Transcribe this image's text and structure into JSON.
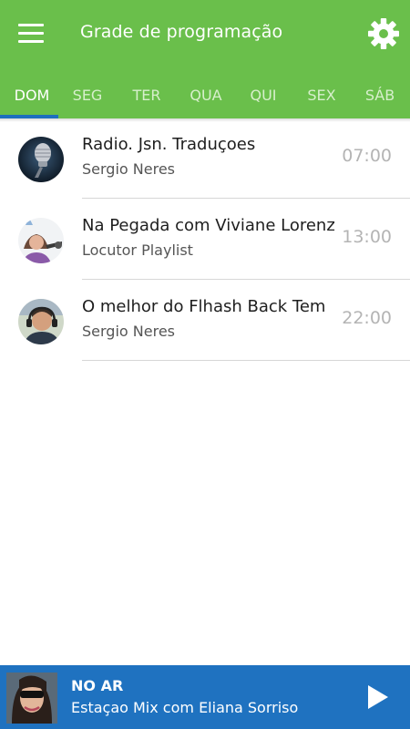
{
  "header": {
    "title": "Grade de programação",
    "menu_icon": "hamburger-menu-icon",
    "settings_icon": "gear-icon",
    "color": "#6abf4b"
  },
  "tabs": [
    {
      "label": "DOM",
      "active": true
    },
    {
      "label": "SEG",
      "active": false
    },
    {
      "label": "TER",
      "active": false
    },
    {
      "label": "QUA",
      "active": false
    },
    {
      "label": "QUI",
      "active": false
    },
    {
      "label": "SEX",
      "active": false
    },
    {
      "label": "SÁB",
      "active": false
    }
  ],
  "schedule": [
    {
      "title": "Radio. Jsn. Traduçoes",
      "host": "Sergio Neres",
      "time": "07:00",
      "avatar": "microphone-avatar"
    },
    {
      "title": "Na Pegada com Viviane Lorenz",
      "host": "Locutor Playlist",
      "time": "13:00",
      "avatar": "host-photo-avatar"
    },
    {
      "title": "O melhor do Flhash Back Tem",
      "host": "Sergio Neres",
      "time": "22:00",
      "avatar": "host-photo-avatar"
    }
  ],
  "player": {
    "label": "NO AR",
    "now_playing": "Estaçao Mix com Eliana Sorriso",
    "play_icon": "play-icon",
    "color": "#1f72c0"
  }
}
